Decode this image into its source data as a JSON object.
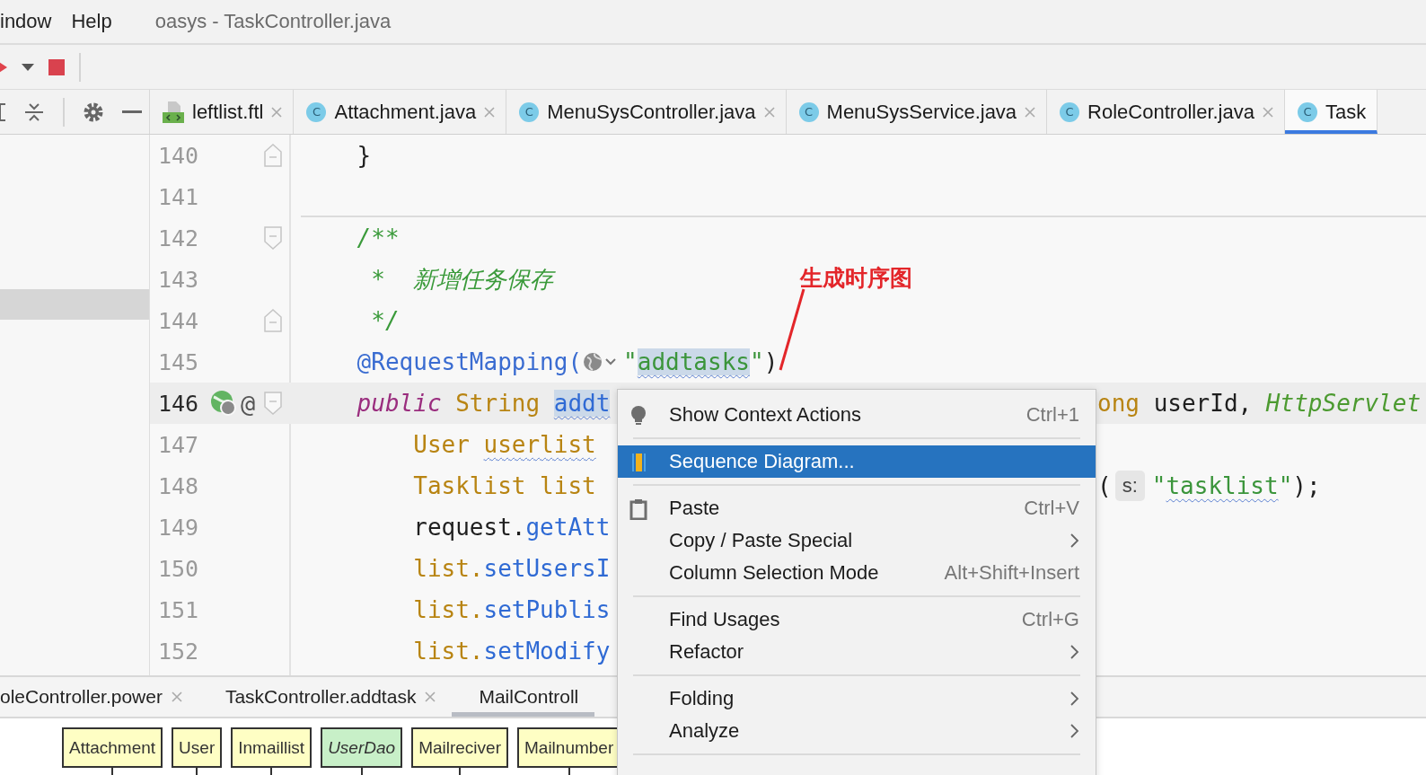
{
  "menubar": {
    "items": [
      {
        "label": "indow"
      },
      {
        "label": "Help"
      }
    ],
    "title": "oasys - TaskController.java"
  },
  "editor_tabs": [
    {
      "label": "leftlist.ftl",
      "kind": "template",
      "closable": true,
      "selected": false
    },
    {
      "label": "Attachment.java",
      "kind": "class",
      "letter": "C",
      "closable": true,
      "selected": false
    },
    {
      "label": "MenuSysController.java",
      "kind": "class",
      "letter": "C",
      "closable": true,
      "selected": false
    },
    {
      "label": "MenuSysService.java",
      "kind": "class",
      "letter": "C",
      "closable": true,
      "selected": false
    },
    {
      "label": "RoleController.java",
      "kind": "class",
      "letter": "C",
      "closable": true,
      "selected": false
    },
    {
      "label": "Task",
      "kind": "class",
      "letter": "C",
      "closable": false,
      "selected": true
    }
  ],
  "lines": [
    {
      "number": "140",
      "current": false,
      "fold_end": true,
      "code": [
        {
          "text": "    }",
          "kind": "plain"
        }
      ]
    },
    {
      "number": "141",
      "current": false,
      "separator": true
    },
    {
      "number": "142",
      "current": false,
      "fold_start": true,
      "code": [
        {
          "text": "    /**",
          "kind": "comment"
        }
      ]
    },
    {
      "number": "143",
      "current": false,
      "code": [
        {
          "text": "     *  新增任务保存",
          "kind": "comment"
        }
      ]
    },
    {
      "number": "144",
      "current": false,
      "fold_end": true,
      "code": [
        {
          "text": "     */",
          "kind": "comment"
        }
      ]
    },
    {
      "number": "145",
      "current": false,
      "code": [
        {
          "text": "    @RequestMapping(",
          "kind": "annotation"
        },
        {
          "kind": "url-hint"
        },
        {
          "text": "\"",
          "kind": "string"
        },
        {
          "text": "addtasks",
          "kind": "string",
          "highlighted": true,
          "squiggly": true
        },
        {
          "text": "\"",
          "kind": "string"
        },
        {
          "text": ")",
          "kind": "plain"
        }
      ]
    },
    {
      "number": "146",
      "current": true,
      "fold_start": true,
      "gutter": [
        {
          "kind": "endpoint"
        },
        {
          "kind": "text",
          "text": "@"
        }
      ],
      "code": [
        {
          "text": "    public ",
          "kind": "keyword"
        },
        {
          "text": "String ",
          "kind": "type"
        },
        {
          "text": "addt",
          "kind": "method",
          "highlighted": true,
          "squiggly": true
        }
      ],
      "code_right": [
        {
          "text": "ong ",
          "kind": "type"
        },
        {
          "text": "userId, ",
          "kind": "plain"
        },
        {
          "text": "HttpServlet",
          "kind": "param-type"
        }
      ]
    },
    {
      "number": "147",
      "current": false,
      "code": [
        {
          "text": "        User ",
          "kind": "type"
        },
        {
          "text": "userlist",
          "kind": "type",
          "squiggly": true
        }
      ]
    },
    {
      "number": "148",
      "current": false,
      "code": [
        {
          "text": "        Tasklist list",
          "kind": "type"
        }
      ],
      "code_right": [
        {
          "text": "(",
          "kind": "plain"
        },
        {
          "text": "s:",
          "kind": "hint"
        },
        {
          "text": "\"",
          "kind": "string"
        },
        {
          "text": "tasklist",
          "kind": "string",
          "squiggly": true
        },
        {
          "text": "\"",
          "kind": "string"
        },
        {
          "text": ");",
          "kind": "plain"
        }
      ]
    },
    {
      "number": "149",
      "current": false,
      "code": [
        {
          "text": "        request.",
          "kind": "plain"
        },
        {
          "text": "getAtt",
          "kind": "method"
        }
      ]
    },
    {
      "number": "150",
      "current": false,
      "code": [
        {
          "text": "        list.",
          "kind": "type"
        },
        {
          "text": "setUsersI",
          "kind": "method"
        }
      ]
    },
    {
      "number": "151",
      "current": false,
      "code": [
        {
          "text": "        list.",
          "kind": "type"
        },
        {
          "text": "setPublis",
          "kind": "method"
        }
      ]
    },
    {
      "number": "152",
      "current": false,
      "code": [
        {
          "text": "        list.",
          "kind": "type"
        },
        {
          "text": "setModify",
          "kind": "method"
        }
      ]
    }
  ],
  "context_menu": {
    "sections": [
      {
        "items": [
          {
            "label": "Show Context Actions",
            "kind": "action",
            "shortcut": "Ctrl+1",
            "submenu": false,
            "selected": false
          }
        ]
      },
      {
        "items": [
          {
            "label": "Sequence Diagram...",
            "kind": "diagram",
            "submenu": false,
            "selected": true
          }
        ]
      },
      {
        "items": [
          {
            "label": "Paste",
            "kind": "paste",
            "shortcut": "Ctrl+V",
            "submenu": false,
            "selected": false
          },
          {
            "label": "Copy / Paste Special",
            "submenu": true,
            "selected": false
          },
          {
            "label": "Column Selection Mode",
            "shortcut": "Alt+Shift+Insert",
            "submenu": false,
            "selected": false
          }
        ]
      },
      {
        "items": [
          {
            "label": "Find Usages",
            "shortcut": "Ctrl+G",
            "submenu": false,
            "selected": false
          },
          {
            "label": "Refactor",
            "submenu": true,
            "selected": false
          }
        ]
      },
      {
        "items": [
          {
            "label": "Folding",
            "submenu": true,
            "selected": false
          },
          {
            "label": "Analyze",
            "submenu": true,
            "selected": false
          }
        ]
      }
    ]
  },
  "annotation": {
    "text": "生成时序图"
  },
  "bottom_tabs": [
    {
      "label": "oleController.power",
      "closable": true,
      "selected": false
    },
    {
      "label": "TaskController.addtask",
      "closable": true,
      "selected": false
    },
    {
      "label": "MailControll",
      "closable": false,
      "selected": true
    }
  ],
  "diagram": {
    "participants": [
      {
        "label": "Attachment",
        "kind": "class"
      },
      {
        "label": "User",
        "kind": "class"
      },
      {
        "label": "Inmaillist",
        "kind": "class"
      },
      {
        "label": "UserDao",
        "kind": "interface"
      },
      {
        "label": "Mailreciver",
        "kind": "class"
      },
      {
        "label": "Mailnumber",
        "kind": "class"
      }
    ]
  }
}
